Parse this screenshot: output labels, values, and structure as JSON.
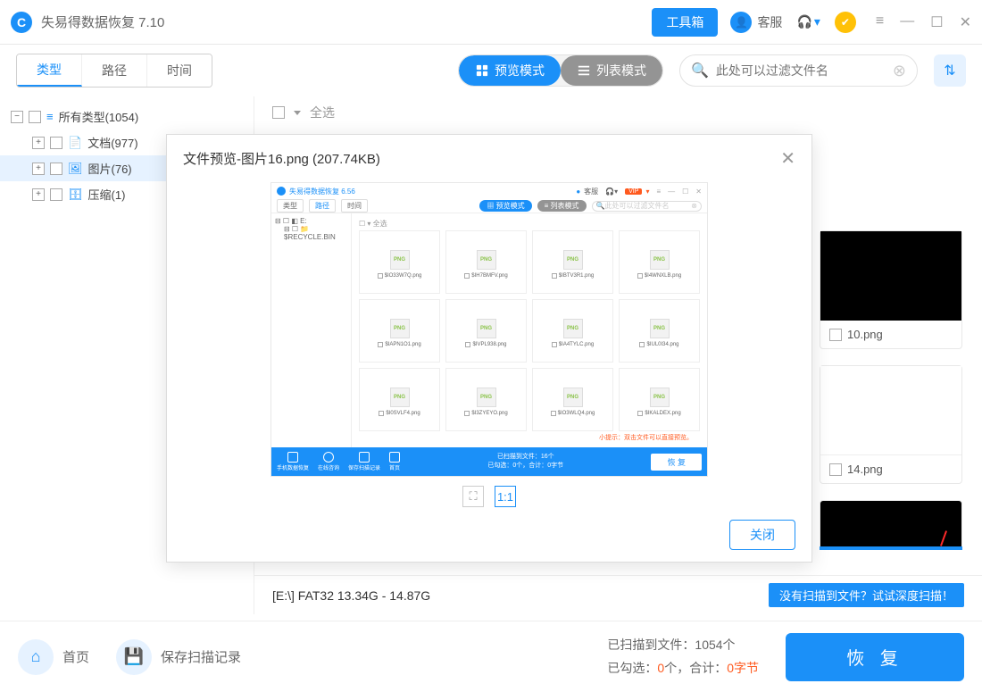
{
  "app": {
    "title": "失易得数据恢复 7.10",
    "toolbox": "工具箱",
    "kefu": "客服"
  },
  "tabs": {
    "type": "类型",
    "path": "路径",
    "time": "时间"
  },
  "view": {
    "preview": "预览模式",
    "list": "列表模式"
  },
  "search": {
    "placeholder": "此处可以过滤文件名"
  },
  "tree": {
    "all": "所有类型(1054)",
    "doc": "文档(977)",
    "img": "图片(76)",
    "zip": "压缩(1)"
  },
  "selectAll": "全选",
  "bgThumbs": {
    "t1": "10.png",
    "t2": "14.png"
  },
  "disk": {
    "info": "[E:\\] FAT32 13.34G - 14.87G",
    "deep": "没有扫描到文件？试试深度扫描！"
  },
  "footer": {
    "home": "首页",
    "save": "保存扫描记录",
    "stats1_a": "已扫描到文件：",
    "stats1_b": "1054个",
    "stats2_a": "已勾选：",
    "stats2_b": "0",
    "stats2_c": "个，合计：",
    "stats2_d": "0字节",
    "recover": "恢 复"
  },
  "modal": {
    "title": "文件预览-图片16.png  (207.74KB)",
    "close": "关闭"
  },
  "mini": {
    "title": "失易得数据恢复 6.56",
    "kefu": "客服",
    "vip": "VIP",
    "tabs": {
      "type": "类型",
      "path": "路径",
      "time": "时间"
    },
    "preview": "预览模式",
    "list": "列表模式",
    "search": "此处可以过滤文件名",
    "side": "$RECYCLE.BIN",
    "selectAll": "全选",
    "cards": [
      "$IO33W7Q.png",
      "$IH7BMFV.png",
      "$IBTV3R1.png",
      "$I4WNXLB.png",
      "$IAPN1O1.png",
      "$IVPL938.png",
      "$IA4TYLC.png",
      "$IUL0I34.png",
      "$I0SVLF4.png",
      "$I3ZYEYO.png",
      "$IO3WLQ4.png",
      "$IKALDEX.png"
    ],
    "hint": "小提示：双击文件可以直接预览。",
    "footerBtns": [
      "手机数据恢复",
      "在线咨询",
      "保存扫描记录",
      "首页"
    ],
    "center1": "已扫描到文件：16个",
    "center2": "已勾选：0个，合计：0字节",
    "recover": "恢 复"
  }
}
